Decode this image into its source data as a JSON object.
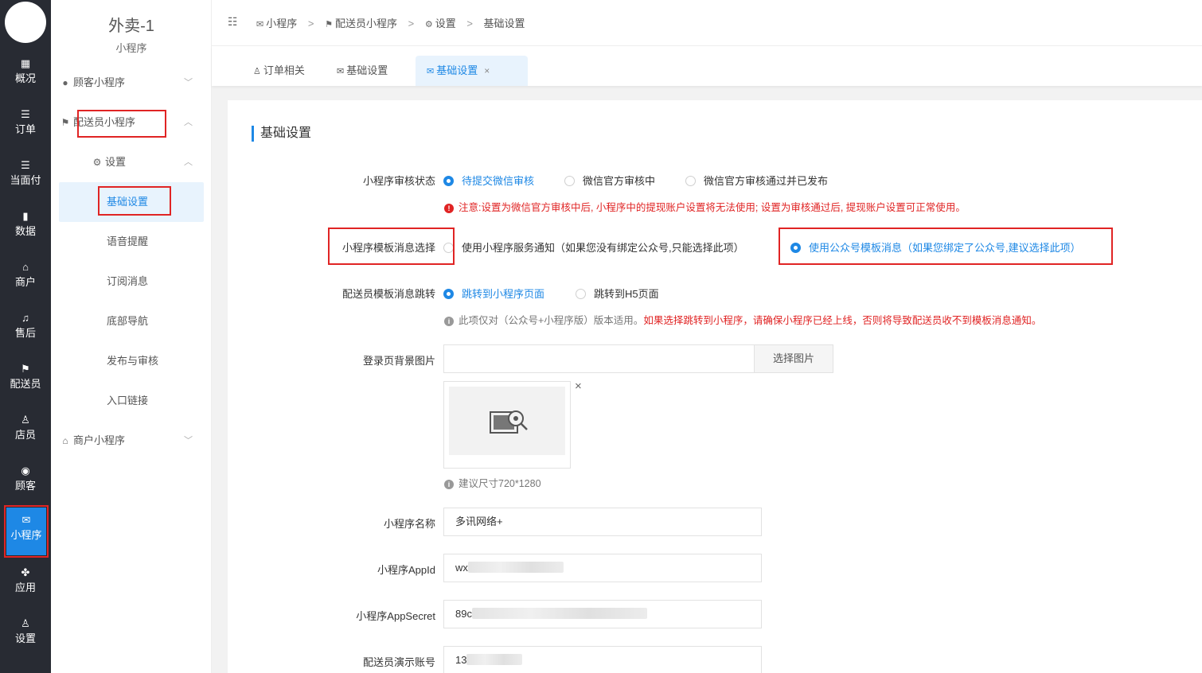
{
  "rail": {
    "items": [
      {
        "icon": "▦",
        "label": "概况"
      },
      {
        "icon": "☰",
        "label": "订单"
      },
      {
        "icon": "☰",
        "label": "当面付"
      },
      {
        "icon": "▮",
        "label": "数据"
      },
      {
        "icon": "⌂",
        "label": "商户"
      },
      {
        "icon": "♫",
        "label": "售后"
      },
      {
        "icon": "⚑",
        "label": "配送员"
      },
      {
        "icon": "♙",
        "label": "店员"
      },
      {
        "icon": "◉",
        "label": "顾客"
      },
      {
        "icon": "✉",
        "label": "小程序"
      },
      {
        "icon": "✤",
        "label": "应用"
      },
      {
        "icon": "♙",
        "label": "设置"
      }
    ]
  },
  "sidebar": {
    "title": "外卖-1",
    "subtitle": "小程序",
    "groups": {
      "customer": "顾客小程序",
      "courier": "配送员小程序",
      "settings": "设置",
      "merchant": "商户小程序"
    },
    "items": [
      "基础设置",
      "语音提醒",
      "订阅消息",
      "底部导航",
      "发布与审核",
      "入口链接"
    ]
  },
  "header": {
    "breadcrumb": [
      "小程序",
      "配送员小程序",
      "设置",
      "基础设置"
    ],
    "separator": ">"
  },
  "tabs": [
    {
      "label": "订单相关"
    },
    {
      "label": "基础设置"
    },
    {
      "label": "基础设置",
      "close": "×"
    }
  ],
  "form": {
    "section_title": "基础设置",
    "audit": {
      "label": "小程序审核状态",
      "options": [
        "待提交微信审核",
        "微信官方审核中",
        "微信官方审核通过并已发布"
      ],
      "selected": 0,
      "note": "注意:设置为微信官方审核中后, 小程序中的提现账户设置将无法使用; 设置为审核通过后, 提现账户设置可正常使用。"
    },
    "template": {
      "label": "小程序模板消息选择",
      "options": [
        "使用小程序服务通知（如果您没有绑定公众号,只能选择此项）",
        "使用公众号模板消息（如果您绑定了公众号,建议选择此项）"
      ],
      "selected": 1
    },
    "jump": {
      "label": "配送员模板消息跳转",
      "options": [
        "跳转到小程序页面",
        "跳转到H5页面"
      ],
      "selected": 0,
      "note_gray": "此项仅对（公众号+小程序版）版本适用。",
      "note_red": "如果选择跳转到小程序，请确保小程序已经上线，否则将导致配送员收不到模板消息通知。"
    },
    "bg_image": {
      "label": "登录页背景图片",
      "value": "",
      "button": "选择图片",
      "close": "×",
      "hint": "建议尺寸720*1280"
    },
    "app_name": {
      "label": "小程序名称",
      "value": "多讯网络+"
    },
    "app_id": {
      "label": "小程序AppId",
      "value": "wx"
    },
    "app_secret": {
      "label": "小程序AppSecret",
      "value": "89c"
    },
    "demo_account": {
      "label": "配送员演示账号",
      "value": "13"
    }
  },
  "colors": {
    "accent": "#1e88e5",
    "danger": "#e02424",
    "rail_bg": "#282b33"
  }
}
